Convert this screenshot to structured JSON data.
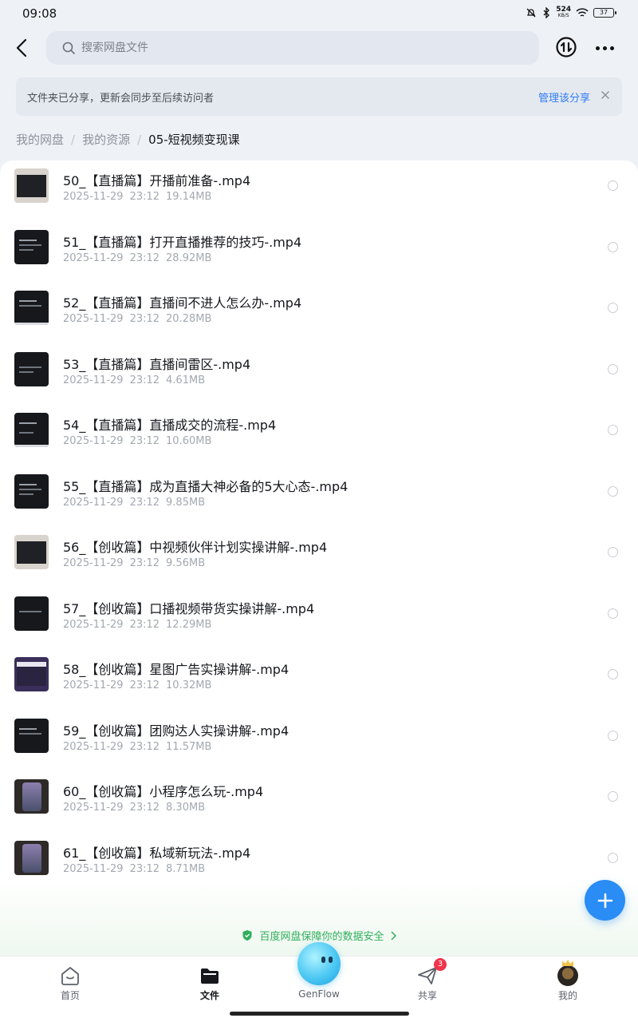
{
  "status": {
    "time": "09:08",
    "net_speed_value": "524",
    "net_speed_unit": "KB/S",
    "battery": "37"
  },
  "search": {
    "placeholder": "搜索网盘文件"
  },
  "banner": {
    "text": "文件夹已分享，更新会同步至后续访问者",
    "manage_label": "管理该分享"
  },
  "breadcrumb": {
    "items": [
      "我的网盘",
      "我的资源"
    ],
    "current": "05-短视频变现课"
  },
  "files": [
    {
      "name": "50_【直播篇】开播前准备-.mp4",
      "date": "2025-11-29",
      "time": "23:12",
      "size": "19.14MB",
      "thumb": "light"
    },
    {
      "name": "51_【直播篇】打开直播推荐的技巧-.mp4",
      "date": "2025-11-29",
      "time": "23:12",
      "size": "28.92MB",
      "thumb": "dark"
    },
    {
      "name": "52_【直播篇】直播间不进人怎么办-.mp4",
      "date": "2025-11-29",
      "time": "23:12",
      "size": "20.28MB",
      "thumb": "dark"
    },
    {
      "name": "53_【直播篇】直播间雷区-.mp4",
      "date": "2025-11-29",
      "time": "23:12",
      "size": "4.61MB",
      "thumb": "dark"
    },
    {
      "name": "54_【直播篇】直播成交的流程-.mp4",
      "date": "2025-11-29",
      "time": "23:12",
      "size": "10.60MB",
      "thumb": "dark"
    },
    {
      "name": "55_【直播篇】成为直播大神必备的5大心态-.mp4",
      "date": "2025-11-29",
      "time": "23:12",
      "size": "9.85MB",
      "thumb": "dark"
    },
    {
      "name": "56_【创收篇】中视频伙伴计划实操讲解-.mp4",
      "date": "2025-11-29",
      "time": "23:12",
      "size": "9.56MB",
      "thumb": "light"
    },
    {
      "name": "57_【创收篇】口播视频带货实操讲解-.mp4",
      "date": "2025-11-29",
      "time": "23:12",
      "size": "12.29MB",
      "thumb": "dark"
    },
    {
      "name": "58_【创收篇】星图广告实操讲解-.mp4",
      "date": "2025-11-29",
      "time": "23:12",
      "size": "10.32MB",
      "thumb": "purple"
    },
    {
      "name": "59_【创收篇】团购达人实操讲解-.mp4",
      "date": "2025-11-29",
      "time": "23:12",
      "size": "11.57MB",
      "thumb": "dark"
    },
    {
      "name": "60_【创收篇】小程序怎么玩-.mp4",
      "date": "2025-11-29",
      "time": "23:12",
      "size": "8.30MB",
      "thumb": "phone"
    },
    {
      "name": "61_【创收篇】私域新玩法-.mp4",
      "date": "2025-11-29",
      "time": "23:12",
      "size": "8.71MB",
      "thumb": "phone"
    }
  ],
  "safety_text": "百度网盘保障你的数据安全",
  "nav": {
    "home": "首页",
    "files": "文件",
    "genflow": "GenFlow",
    "share": "共享",
    "share_badge": "3",
    "mine": "我的"
  },
  "colors": {
    "accent": "#2f7df6",
    "fab": "#2a8cf5",
    "safety": "#2fae5c",
    "badge": "#f0344b"
  },
  "icons": [
    "back-arrow-icon",
    "search-icon",
    "sort-icon",
    "more-icon",
    "close-icon",
    "plus-icon",
    "shield-icon",
    "chevron-right-icon",
    "home-icon",
    "folder-icon",
    "send-icon"
  ]
}
